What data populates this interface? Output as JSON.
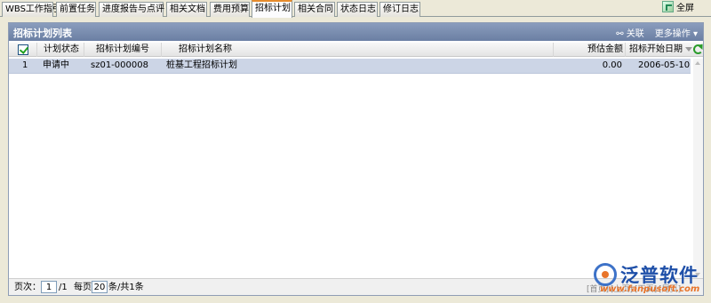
{
  "tabs": [
    {
      "label": "WBS工作指引",
      "active": false
    },
    {
      "label": "前置任务",
      "active": false
    },
    {
      "label": "进度报告与点评",
      "active": false
    },
    {
      "label": "相关文档",
      "active": false
    },
    {
      "label": "费用预算",
      "active": false
    },
    {
      "label": "招标计划",
      "active": true
    },
    {
      "label": "相关合同",
      "active": false
    },
    {
      "label": "状态日志",
      "active": false
    },
    {
      "label": "修订日志",
      "active": false
    }
  ],
  "fullscreen_label": "全屏",
  "panel": {
    "title": "招标计划列表",
    "actions": {
      "link_label": "关联",
      "more_label": "更多操作"
    }
  },
  "grid": {
    "columns": [
      "计划状态",
      "招标计划编号",
      "招标计划名称",
      "预估金额",
      "招标开始日期"
    ],
    "rows": [
      {
        "index": "1",
        "status": "申请中",
        "code": "sz01-000008",
        "name": "桩基工程招标计划",
        "amount": "0.00",
        "start_date": "2006-05-10"
      }
    ]
  },
  "footer": {
    "page_label": "页次：",
    "page_value": "1",
    "page_total": "/1",
    "per_page_label": "每页",
    "per_page_value": "20",
    "summary": "条/共1条",
    "pager": [
      "[首页]",
      "[上页]",
      "[下页]",
      "[尾页]"
    ]
  },
  "brand": {
    "name": "泛普软件",
    "url": "www.fanpusoft.com"
  },
  "colors": {
    "header_bg": "#6b7fa3",
    "row_selected": "#ccd5e6",
    "active_tab_accent": "#e68b2c"
  }
}
